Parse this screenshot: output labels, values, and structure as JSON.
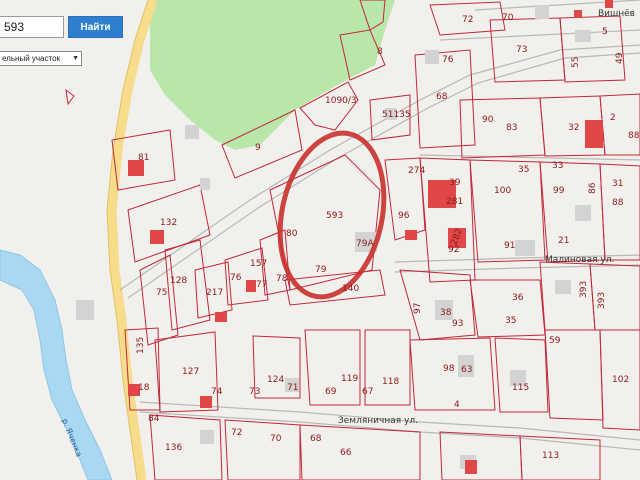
{
  "search": {
    "value": "593",
    "button_label": "Найти"
  },
  "type_select": {
    "selected": "ельный участок"
  },
  "streets": {
    "vishnevaya": "Вишнёв",
    "malinovaya": "Малиновая ул.",
    "zemlyanichnaya": "Земляничная ул."
  },
  "river": {
    "name": "р. Яченка"
  },
  "plots": {
    "p593": "593",
    "p79A": "79А",
    "p79": "79",
    "p80": "80",
    "p96": "96",
    "p274": "274",
    "p281": "281",
    "p282": "282",
    "p92": "92",
    "p91": "91",
    "p100": "100",
    "p99": "99",
    "p86": "86",
    "p31": "31",
    "p88": "88",
    "p39": "39",
    "p33": "33",
    "p35top": "35",
    "p21": "21",
    "p36": "36",
    "p35": "35",
    "p38": "38",
    "p93": "93",
    "p97": "97",
    "p393": "393",
    "p393b": "393",
    "p59": "59",
    "p98": "98",
    "p63": "63",
    "p115": "115",
    "p4": "4",
    "p119": "119",
    "p118": "118",
    "p69": "69",
    "p67": "67",
    "p124": "124",
    "p71": "71",
    "p73": "73",
    "p74": "74",
    "p127": "127",
    "p135": "135",
    "p84": "84",
    "p136": "136",
    "p72": "72",
    "p70": "70",
    "p68b": "68",
    "p66": "66",
    "p113": "113",
    "p102": "102",
    "p157": "157",
    "p76": "76",
    "p78": "78",
    "p77": "77",
    "p217": "217",
    "p128": "128",
    "p75": "75",
    "p132": "132",
    "p81": "81",
    "p8": "8",
    "p9": "9",
    "p1090": "1090/3",
    "p51135": "51135",
    "p76top": "76",
    "p68": "68",
    "p90": "90",
    "p83": "83",
    "p32": "32",
    "p2": "2",
    "p88top": "88",
    "p72top": "72",
    "p70top": "70",
    "p73top": "73",
    "p55": "55",
    "p49": "49",
    "p5": "5",
    "p18": "18",
    "p140": "140"
  },
  "colors": {
    "background": "#f2f0ec",
    "forest": "#b9e6a9",
    "plot_border": "#c0283a",
    "building": "#d3d3d3",
    "building_red": "#e04848",
    "road_yellow": "#f7dc8c",
    "river": "#a9d8f2",
    "highlight_circle": "#c9302c",
    "button": "#2f7fd1"
  }
}
